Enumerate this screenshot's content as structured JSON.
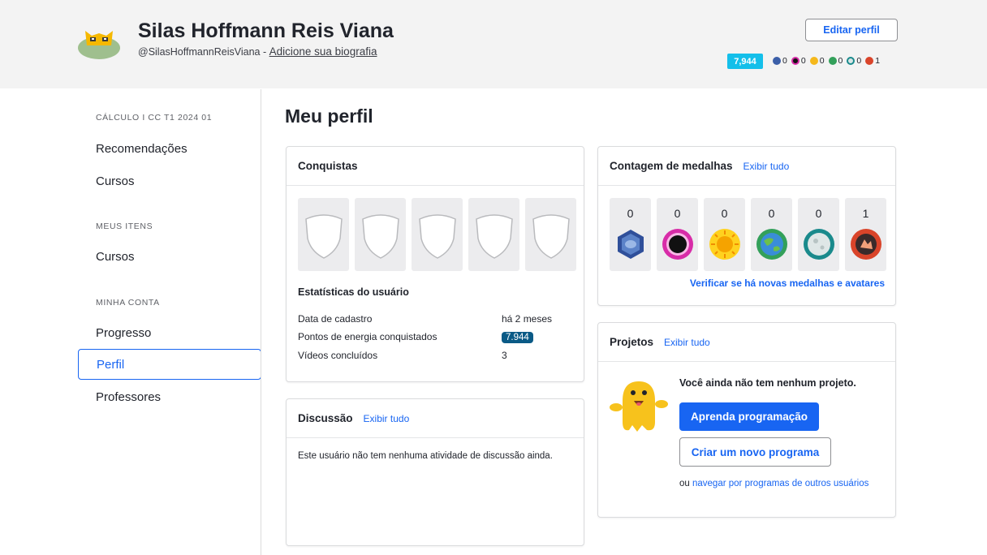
{
  "header": {
    "name": "Silas Hoffmann Reis Viana",
    "handle": "@SilasHoffmannReisViana",
    "separator": " - ",
    "bio_link": "Adicione sua biografia",
    "edit_button": "Editar perfil",
    "points": "7,944",
    "mini_medals": [
      {
        "icon": "meteorite-badge-icon",
        "color": "#3b5fa8",
        "count": "0"
      },
      {
        "icon": "black-hole-badge-icon",
        "color": "#d82ca8",
        "count": "0"
      },
      {
        "icon": "sun-badge-icon",
        "color": "#f5b81b",
        "count": "0"
      },
      {
        "icon": "earth-badge-icon",
        "color": "#33a05a",
        "count": "0"
      },
      {
        "icon": "moon-badge-icon",
        "color": "#1a8a8c",
        "count": "0"
      },
      {
        "icon": "challenge-patch-icon",
        "color": "#d9442a",
        "count": "1"
      }
    ]
  },
  "sidebar": {
    "course_label": "CÁLCULO I CC T1 2024 01",
    "course_items": [
      "Recomendações",
      "Cursos"
    ],
    "my_items_label": "MEUS ITENS",
    "my_items": [
      "Cursos"
    ],
    "account_label": "MINHA CONTA",
    "account_items": [
      "Progresso",
      "Perfil",
      "Professores"
    ]
  },
  "main": {
    "title": "Meu perfil",
    "achievements": {
      "title": "Conquistas",
      "stats_title": "Estatísticas do usuário",
      "stats": [
        {
          "label": "Data de cadastro",
          "value": "há 2 meses"
        },
        {
          "label": "Pontos de energia conquistados",
          "value": "7.944"
        },
        {
          "label": "Vídeos concluídos",
          "value": "3"
        }
      ]
    },
    "medals": {
      "title": "Contagem de medalhas",
      "link": "Exibir tudo",
      "counts": [
        "0",
        "0",
        "0",
        "0",
        "0",
        "1"
      ],
      "verify": "Verificar se há novas medalhas e avatares"
    },
    "projects": {
      "title": "Projetos",
      "link": "Exibir tudo",
      "message": "Você ainda não tem nenhum projeto.",
      "learn_button": "Aprenda programação",
      "new_button": "Criar um novo programa",
      "browse_prefix": "ou ",
      "browse_link": "navegar por programas de outros usuários"
    },
    "discussion": {
      "title": "Discussão",
      "link": "Exibir tudo",
      "empty": "Este usuário não tem nenhuma atividade de discussão ainda."
    }
  }
}
